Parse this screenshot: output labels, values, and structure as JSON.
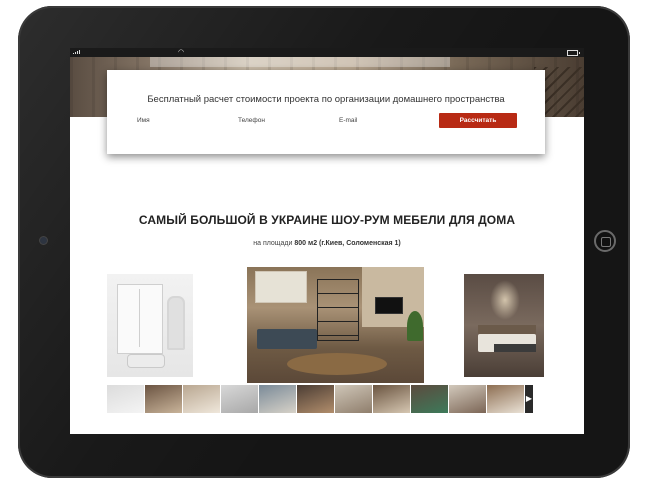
{
  "form": {
    "title": "Бесплатный расчет стоимости проекта по организации домашнего пространства",
    "fields": [
      {
        "key": "name",
        "label": "Имя"
      },
      {
        "key": "phone",
        "label": "Телефон"
      },
      {
        "key": "email",
        "label": "E-mail"
      }
    ],
    "submit_label": "Рассчитать"
  },
  "showroom": {
    "headline": "САМЫЙ БОЛЬШОЙ В УКРАИНЕ ШОУ-РУМ МЕБЕЛИ ДЛЯ ДОМА",
    "subline_prefix": "на площади",
    "subline_area": "800 м2",
    "subline_location": "(г.Киев, Соломенская 1)"
  },
  "gallery": {
    "thumbs": [
      {
        "colors": [
          "#dcdcdc",
          "#f4f4f4"
        ]
      },
      {
        "colors": [
          "#6b5442",
          "#c9b49a"
        ]
      },
      {
        "colors": [
          "#b9a791",
          "#efe7db"
        ]
      },
      {
        "colors": [
          "#d8d8d8",
          "#a8a8a8"
        ]
      },
      {
        "colors": [
          "#7a8a98",
          "#d7d2c8"
        ]
      },
      {
        "colors": [
          "#4b3d34",
          "#b28e6c"
        ]
      },
      {
        "colors": [
          "#cfc6b8",
          "#8f7e6c"
        ]
      },
      {
        "colors": [
          "#6a5440",
          "#d6c7b2"
        ]
      },
      {
        "colors": [
          "#5c4a3e",
          "#3d7a5a"
        ]
      },
      {
        "colors": [
          "#d2c9bc",
          "#7c6656"
        ]
      },
      {
        "colors": [
          "#8d6e52",
          "#eae2d6"
        ]
      }
    ],
    "next_arrow": "▶"
  },
  "ui_colors": {
    "accent": "#b82a14",
    "bezel": "#151515"
  },
  "icons": {
    "signal": "signal-icon",
    "wifi": "wifi-icon",
    "battery": "battery-icon"
  }
}
